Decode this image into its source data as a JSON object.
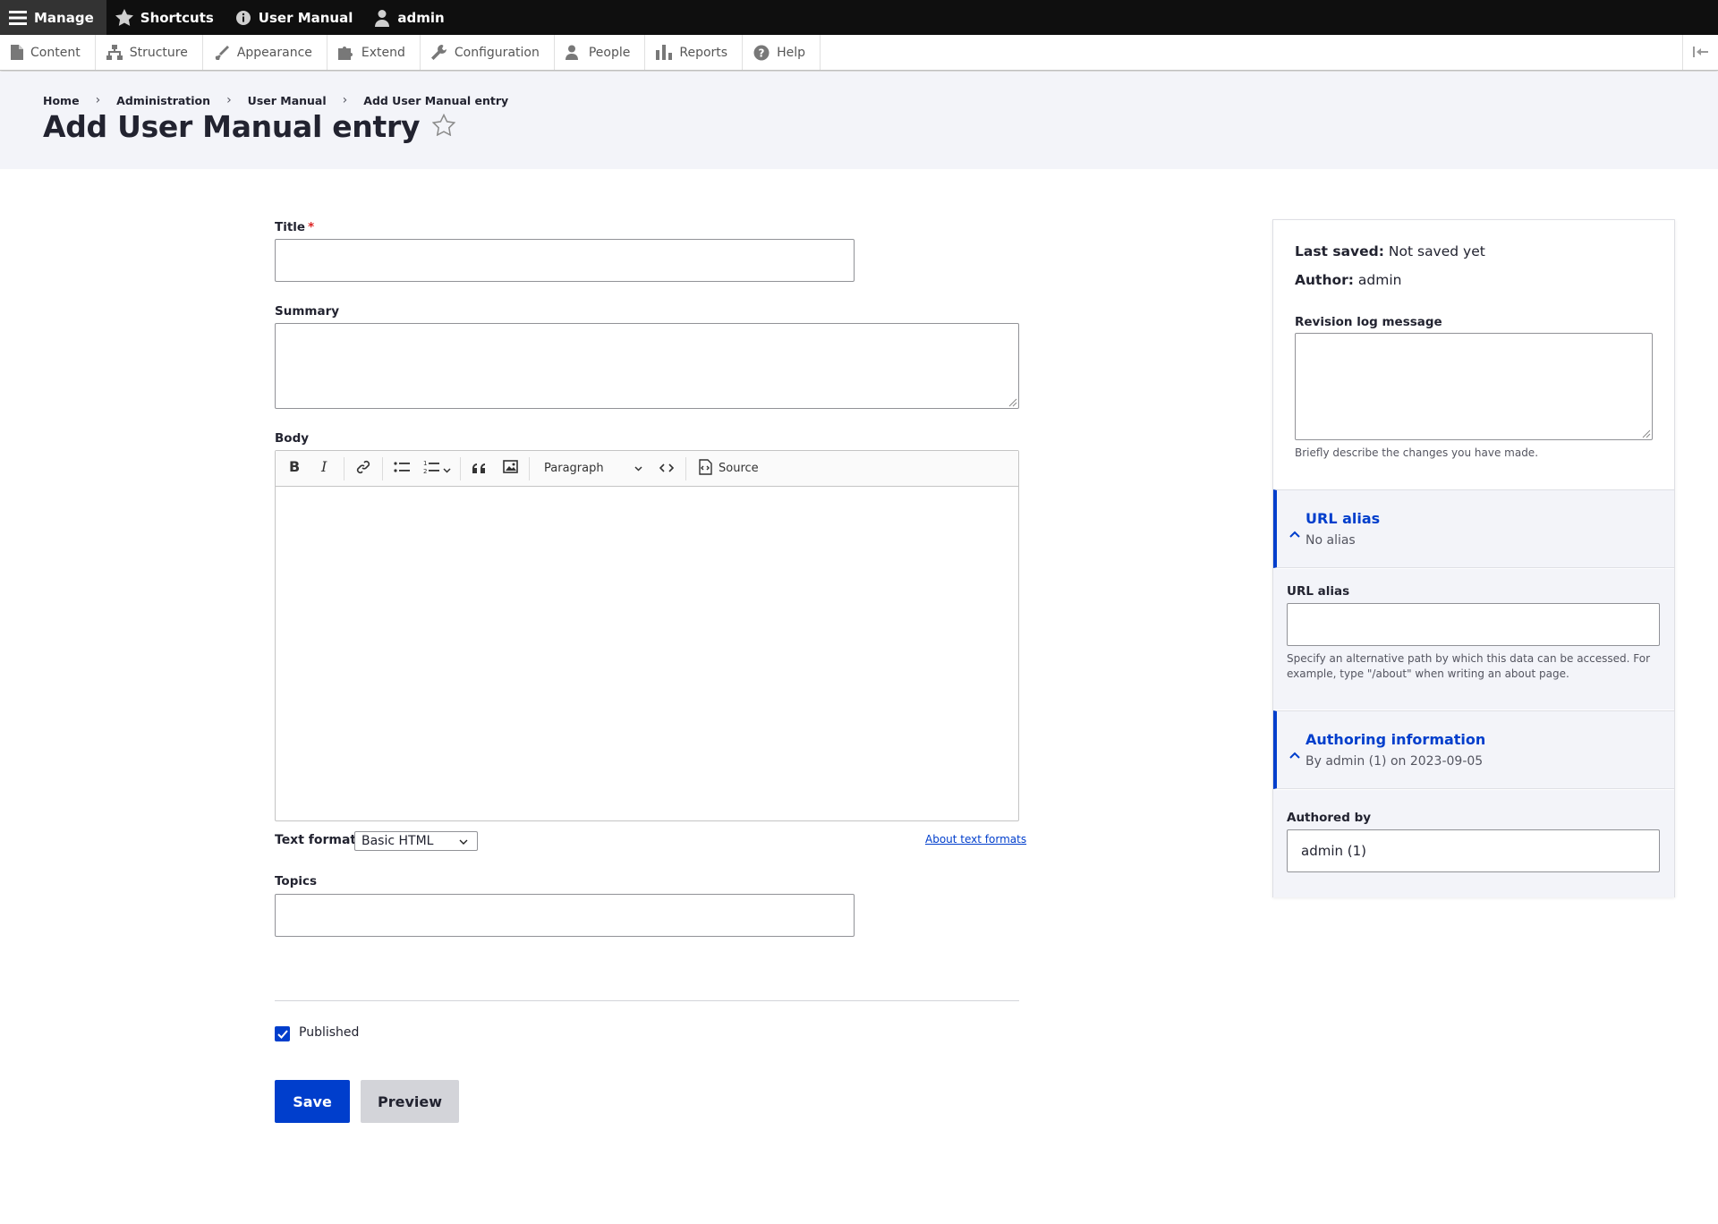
{
  "toolbar": {
    "manage": "Manage",
    "shortcuts": "Shortcuts",
    "user_manual": "User Manual",
    "user": "admin"
  },
  "tray": {
    "items": [
      "Content",
      "Structure",
      "Appearance",
      "Extend",
      "Configuration",
      "People",
      "Reports",
      "Help"
    ]
  },
  "breadcrumb": [
    "Home",
    "Administration",
    "User Manual",
    "Add User Manual entry"
  ],
  "page": {
    "title": "Add User Manual entry"
  },
  "form": {
    "title_label": "Title",
    "title_required": "*",
    "title_value": "",
    "summary_label": "Summary",
    "body_label": "Body",
    "editor": {
      "paragraph": "Paragraph",
      "source": "Source"
    },
    "text_format_label": "Text format",
    "text_format_value": "Basic HTML",
    "about_formats": "About text formats",
    "topics_label": "Topics",
    "published_label": "Published",
    "published": true,
    "save": "Save",
    "preview": "Preview"
  },
  "sidebar": {
    "last_saved_label": "Last saved:",
    "last_saved_value": "Not saved yet",
    "author_label": "Author:",
    "author_value": "admin",
    "revision_label": "Revision log message",
    "revision_desc": "Briefly describe the changes you have made.",
    "url_alias_title": "URL alias",
    "url_alias_summary": "No alias",
    "url_alias_field_label": "URL alias",
    "url_alias_desc": "Specify an alternative path by which this data can be accessed. For example, type \"/about\" when writing an about page.",
    "authoring_title": "Authoring information",
    "authoring_summary": "By admin (1) on 2023-09-05",
    "authored_by_label": "Authored by",
    "authored_by_value": "admin (1)"
  },
  "colors": {
    "accent": "#003ecc",
    "toolbar": "#0f0f0f",
    "header_bg": "#f3f4f9",
    "required": "#dc2323"
  }
}
